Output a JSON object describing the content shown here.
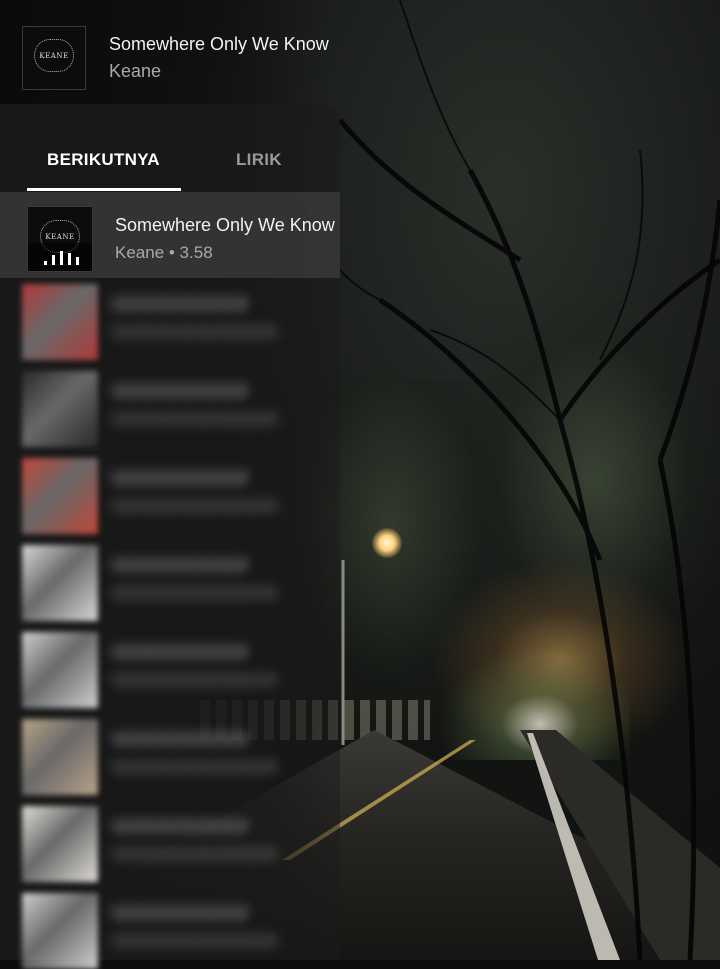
{
  "now_playing": {
    "title": "Somewhere Only We Know",
    "artist": "Keane",
    "album_art_text": "KEANE"
  },
  "tabs": [
    {
      "label": "BERIKUTNYA",
      "active": true
    },
    {
      "label": "LIRIK",
      "active": false
    }
  ],
  "current_track": {
    "title": "Somewhere Only We Know",
    "meta": "Keane • 3.58",
    "album_art_text": "KEANE",
    "state": "playing",
    "icon": "equalizer-icon"
  },
  "queue": [
    {
      "blurred": true,
      "color": "#b23a3a"
    },
    {
      "blurred": true,
      "color": "#2a2a2a"
    },
    {
      "blurred": true,
      "color": "#c0473a"
    },
    {
      "blurred": true,
      "color": "#d8d8d8"
    },
    {
      "blurred": true,
      "color": "#d0d0d0"
    },
    {
      "blurred": true,
      "color": "#b9a489"
    },
    {
      "blurred": true,
      "color": "#e0ddd6"
    },
    {
      "blurred": true,
      "color": "#cfcfcf"
    }
  ],
  "colors": {
    "panel_bg": "#1a1a1a",
    "current_row_bg": "#3c3c3c",
    "active_tab": "#ffffff",
    "inactive_tab": "#9a9a9a",
    "secondary_text": "#a9a9a9"
  }
}
